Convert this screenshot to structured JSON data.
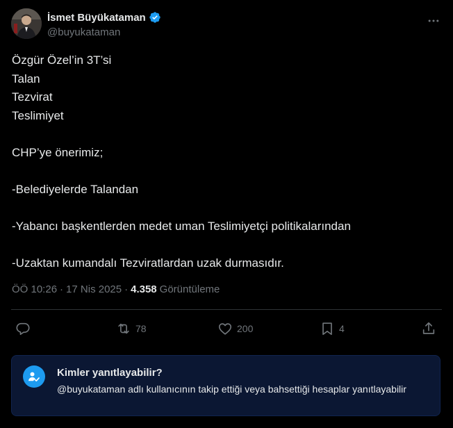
{
  "author": {
    "display_name": "İsmet Büyükataman",
    "handle": "@buyukataman",
    "verified": true
  },
  "tweet": {
    "lines": [
      "Özgür Özel’in 3T’si",
      "Talan",
      "Tezvirat",
      "Teslimiyet",
      "",
      "CHP’ye önerimiz;",
      "",
      "-Belediyelerde Talandan",
      "",
      "-Yabancı başkentlerden medet uman Teslimiyetçi politikalarından",
      "",
      "-Uzaktan kumandalı Tezviratlardan uzak durmasıdır."
    ],
    "time": "ÖÖ 10:26",
    "separator": "·",
    "date": "17 Nis 2025",
    "views_count": "4.358",
    "views_label": "Görüntüleme"
  },
  "actions": {
    "reply_icon": "reply-icon",
    "retweet_count": "78",
    "like_count": "200",
    "bookmark_count": "4",
    "share_icon": "share-icon"
  },
  "reply_settings": {
    "title": "Kimler yanıtlayabilir?",
    "description": "@buyukataman adlı kullanıcının takip ettiği veya bahsettiği hesaplar yanıtlayabilir"
  },
  "colors": {
    "background": "#000000",
    "text": "#e7e9ea",
    "muted": "#71767b",
    "accent": "#1d9bf0",
    "reply_box": "#0b1733"
  }
}
